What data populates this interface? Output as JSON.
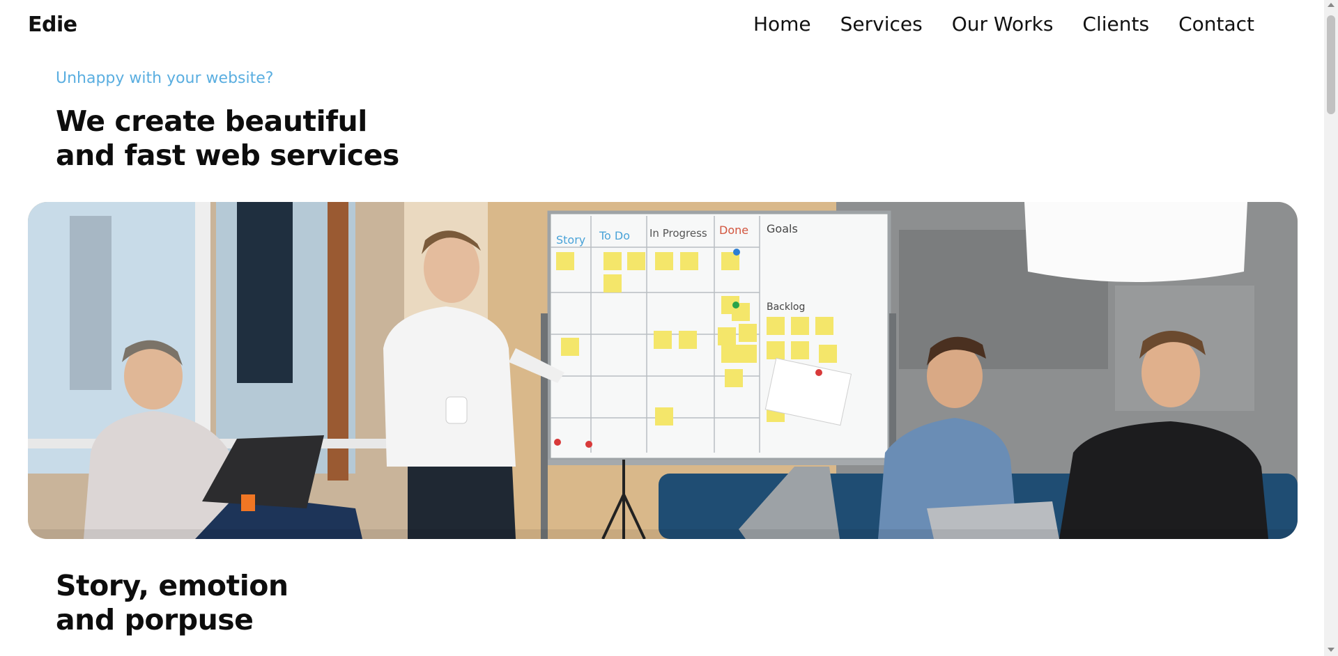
{
  "brand": {
    "name": "Edie"
  },
  "nav": {
    "items": [
      {
        "label": "Home"
      },
      {
        "label": "Services"
      },
      {
        "label": "Our Works"
      },
      {
        "label": "Clients"
      },
      {
        "label": "Contact"
      }
    ]
  },
  "hero": {
    "eyebrow": "Unhappy with your website?",
    "headline_line1": "We create beautiful",
    "headline_line2": "and fast web services"
  },
  "whiteboard": {
    "columns": [
      "Story",
      "To Do",
      "In Progress",
      "Done",
      "Goals"
    ],
    "backlog_label": "Backlog"
  },
  "section": {
    "title_line1": "Story, emotion",
    "title_line2": "and porpuse"
  },
  "colors": {
    "accent": "#5aaee0",
    "text": "#111111",
    "background": "#ffffff"
  }
}
